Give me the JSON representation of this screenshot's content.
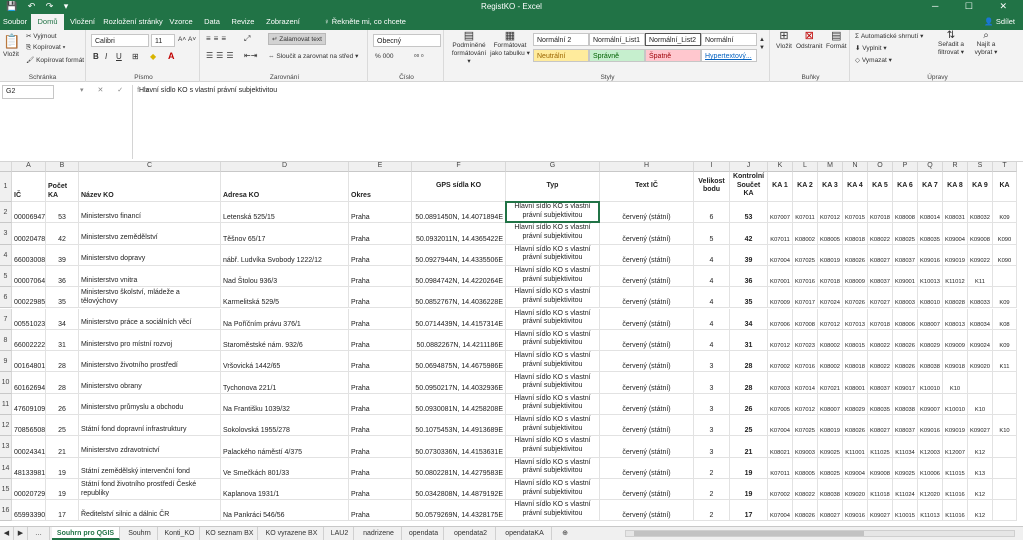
{
  "titlebar": {
    "title": "RegistKO - Excel",
    "qat": "💾 ↶ ↷ ▾",
    "window_controls": "─ ☐ ✕"
  },
  "tabs": [
    "Soubor",
    "Domů",
    "Vložení",
    "Rozložení stránky",
    "Vzorce",
    "Data",
    "Revize",
    "Zobrazení"
  ],
  "tell_me": "Řekněte mi, co chcete udělat...",
  "share": "Sdílet",
  "ribbon": {
    "clipboard": {
      "label": "Schránka",
      "paste": "Vložit",
      "cut": "Vyjmout",
      "copy": "Kopírovat ▾",
      "format_painter": "Kopírovat formát"
    },
    "font": {
      "label": "Písmo",
      "name": "Calibri",
      "size": "11",
      "grow": "A˄",
      "shrink": "A˅",
      "bold": "B",
      "italic": "I",
      "underline": "U"
    },
    "alignment": {
      "label": "Zarovnání",
      "wrap": "Zalamovat text",
      "merge": "Sloučit a zarovnat na střed ▾"
    },
    "number": {
      "label": "Číslo",
      "format": "Obecný",
      "currency": "% 000",
      "dec": "⁰⁰ ⁰"
    },
    "styles": {
      "label": "Styly",
      "conditional": "Podmíněné formátování ▾",
      "as_table": "Formátovat jako tabulku ▾",
      "items": [
        "Normální 2",
        "Normální_List1",
        "Normální_List2",
        "Normální",
        "Neutrální",
        "Správně",
        "Špatně",
        "Hypertextový..."
      ]
    },
    "cells": {
      "label": "Buňky",
      "insert": "Vložit",
      "delete": "Odstranit",
      "format": "Formát"
    },
    "editing": {
      "label": "Úpravy",
      "autosum": "Automatické shrnutí ▾",
      "fill": "Vyplnit ▾",
      "clear": "Vymazat ▾",
      "sort": "Seřadit a filtrovat ▾",
      "find": "Najít a vybrat ▾"
    }
  },
  "namebox": "G2",
  "fx_icons": "▾ ✕ ✓ fx",
  "formula": "Hlavní sídlo KO s vlastní právní subjektivitou",
  "colors": {
    "accent": "#217346",
    "ribbon_bg": "#f3f3f3",
    "neutral": "#ffeb9c",
    "good": "#c6efce",
    "bad": "#ffc7ce"
  },
  "columns": [
    "A",
    "B",
    "C",
    "D",
    "E",
    "F",
    "G",
    "H",
    "I",
    "J",
    "K",
    "L",
    "M",
    "N",
    "O",
    "P",
    "Q",
    "R",
    "S",
    "T"
  ],
  "headers": [
    "IČ",
    "Počet KA",
    "Název KO",
    "Adresa KO",
    "Okres",
    "GPS sídla KO",
    "Typ",
    "Text IČ",
    "Velikost bodu",
    "Kontrolní Součet KA",
    "KA 1",
    "KA 2",
    "KA 3",
    "KA 4",
    "KA 5",
    "KA 6",
    "KA 7",
    "KA 8",
    "KA 9",
    "KA"
  ],
  "rows": [
    {
      "n": "2",
      "a": "00006947",
      "b": "53",
      "c": "Ministerstvo financí",
      "d": "Letenská 525/15",
      "e": "Praha",
      "f": "50.0891450N, 14.4071894E",
      "g": "Hlavní sídlo KO s vlastní právní subjektivitou",
      "h": "červený (státní)",
      "i": "6",
      "j": "53",
      "ka": [
        "K07007",
        "K07011",
        "K07012",
        "K07015",
        "K07018",
        "K08008",
        "K08014",
        "K08031",
        "K08032",
        "K09"
      ]
    },
    {
      "n": "3",
      "a": "00020478",
      "b": "42",
      "c": "Ministerstvo zemědělství",
      "d": "Těšnov 65/17",
      "e": "Praha",
      "f": "50.0932011N, 14.4365422E",
      "g": "Hlavní sídlo KO s vlastní právní subjektivitou",
      "h": "červený (státní)",
      "i": "5",
      "j": "42",
      "ka": [
        "K07011",
        "K08002",
        "K08005",
        "K08018",
        "K08022",
        "K08025",
        "K08035",
        "K09004",
        "K09008",
        "K090"
      ]
    },
    {
      "n": "4",
      "a": "66003008",
      "b": "39",
      "c": "Ministerstvo dopravy",
      "d": "nábř. Ludvíka Svobody 1222/12",
      "e": "Praha",
      "f": "50.0927944N, 14.4335506E",
      "g": "Hlavní sídlo KO s vlastní právní subjektivitou",
      "h": "červený (státní)",
      "i": "4",
      "j": "39",
      "ka": [
        "K07004",
        "K07025",
        "K08019",
        "K08026",
        "K08027",
        "K08037",
        "K09016",
        "K09019",
        "K09022",
        "K090"
      ]
    },
    {
      "n": "5",
      "a": "00007064",
      "b": "36",
      "c": "Ministerstvo vnitra",
      "d": "Nad Štolou 936/3",
      "e": "Praha",
      "f": "50.0984742N, 14.4220264E",
      "g": "Hlavní sídlo KO s vlastní právní subjektivitou",
      "h": "červený (státní)",
      "i": "4",
      "j": "36",
      "ka": [
        "K07001",
        "K07016",
        "K07018",
        "K08009",
        "K08037",
        "K09001",
        "K10013",
        "K11012",
        "K11"
      ]
    },
    {
      "n": "6",
      "a": "00022985",
      "b": "35",
      "c": "Ministerstvo školství, mládeže a tělovýchovy",
      "d": "Karmelitská 529/5",
      "e": "Praha",
      "f": "50.0852767N, 14.4036228E",
      "g": "Hlavní sídlo KO s vlastní právní subjektivitou",
      "h": "červený (státní)",
      "i": "4",
      "j": "35",
      "ka": [
        "K07009",
        "K07017",
        "K07024",
        "K07026",
        "K07027",
        "K08003",
        "K08010",
        "K08028",
        "K08033",
        "K09"
      ]
    },
    {
      "n": "7",
      "a": "00551023",
      "b": "34",
      "c": "Ministerstvo práce a sociálních věcí",
      "d": "Na Poříčním právu 376/1",
      "e": "Praha",
      "f": "50.0714439N, 14.4157314E",
      "g": "Hlavní sídlo KO s vlastní právní subjektivitou",
      "h": "červený (státní)",
      "i": "4",
      "j": "34",
      "ka": [
        "K07006",
        "K07008",
        "K07012",
        "K07013",
        "K07018",
        "K08006",
        "K08007",
        "K08013",
        "K08034",
        "K08"
      ]
    },
    {
      "n": "8",
      "a": "66002222",
      "b": "31",
      "c": "Ministerstvo pro místní rozvoj",
      "d": "Staroměstské nám. 932/6",
      "e": "Praha",
      "f": "50.0882267N, 14.4211186E",
      "g": "Hlavní sídlo KO s vlastní právní subjektivitou",
      "h": "červený (státní)",
      "i": "4",
      "j": "31",
      "ka": [
        "K07012",
        "K07023",
        "K08002",
        "K08015",
        "K08022",
        "K08026",
        "K08029",
        "K09009",
        "K09024",
        "K09"
      ]
    },
    {
      "n": "9",
      "a": "00164801",
      "b": "28",
      "c": "Ministerstvo životního prostředí",
      "d": "Vršovická 1442/65",
      "e": "Praha",
      "f": "50.0694875N, 14.4675986E",
      "g": "Hlavní sídlo KO s vlastní právní subjektivitou",
      "h": "červený (státní)",
      "i": "3",
      "j": "28",
      "ka": [
        "K07002",
        "K07016",
        "K08002",
        "K08018",
        "K08022",
        "K08026",
        "K08038",
        "K09018",
        "K09020",
        "K11"
      ]
    },
    {
      "n": "10",
      "a": "60162694",
      "b": "28",
      "c": "Ministerstvo obrany",
      "d": "Tychonova 221/1",
      "e": "Praha",
      "f": "50.0950217N, 14.4032936E",
      "g": "Hlavní sídlo KO s vlastní právní subjektivitou",
      "h": "červený (státní)",
      "i": "3",
      "j": "28",
      "ka": [
        "K07003",
        "K07014",
        "K07021",
        "K08001",
        "K08037",
        "K09017",
        "K10010",
        "K10"
      ]
    },
    {
      "n": "11",
      "a": "47609109",
      "b": "26",
      "c": "Ministerstvo průmyslu a obchodu",
      "d": "Na Františku 1039/32",
      "e": "Praha",
      "f": "50.0930081N, 14.4258208E",
      "g": "Hlavní sídlo KO s vlastní právní subjektivitou",
      "h": "červený (státní)",
      "i": "3",
      "j": "26",
      "ka": [
        "K07005",
        "K07012",
        "K08007",
        "K08029",
        "K08035",
        "K08038",
        "K09007",
        "K10010",
        "K10"
      ]
    },
    {
      "n": "12",
      "a": "70856508",
      "b": "25",
      "c": "Státní fond dopravní infrastruktury",
      "d": "Sokolovská 1955/278",
      "e": "Praha",
      "f": "50.1075453N, 14.4913689E",
      "g": "Hlavní sídlo KO s vlastní právní subjektivitou",
      "h": "červený (státní)",
      "i": "3",
      "j": "25",
      "ka": [
        "K07004",
        "K07025",
        "K08019",
        "K08026",
        "K08027",
        "K08037",
        "K09016",
        "K09019",
        "K09027",
        "K10"
      ]
    },
    {
      "n": "13",
      "a": "00024341",
      "b": "21",
      "c": "Ministerstvo zdravotnictví",
      "d": "Palackého náměstí 4/375",
      "e": "Praha",
      "f": "50.0730336N, 14.4153631E",
      "g": "Hlavní sídlo KO s vlastní právní subjektivitou",
      "h": "červený (státní)",
      "i": "3",
      "j": "21",
      "ka": [
        "K08021",
        "K09003",
        "K09025",
        "K11001",
        "K11025",
        "K11034",
        "K12003",
        "K12007",
        "K12"
      ]
    },
    {
      "n": "14",
      "a": "48133981",
      "b": "19",
      "c": "Státní zemědělský intervenční fond",
      "d": "Ve Smečkách 801/33",
      "e": "Praha",
      "f": "50.0802281N, 14.4279583E",
      "g": "Hlavní sídlo KO s vlastní právní subjektivitou",
      "h": "červený (státní)",
      "i": "2",
      "j": "19",
      "ka": [
        "K07011",
        "K08005",
        "K08025",
        "K09004",
        "K09008",
        "K09025",
        "K10006",
        "K11015",
        "K13"
      ]
    },
    {
      "n": "15",
      "a": "00020729",
      "b": "19",
      "c": "Státní fond životního prostředí České republiky",
      "d": "Kaplanova 1931/1",
      "e": "Praha",
      "f": "50.0342808N, 14.4879192E",
      "g": "Hlavní sídlo KO s vlastní právní subjektivitou",
      "h": "červený (státní)",
      "i": "2",
      "j": "19",
      "ka": [
        "K07002",
        "K08022",
        "K08038",
        "K09020",
        "K11018",
        "K11024",
        "K12020",
        "K11016",
        "K12"
      ]
    },
    {
      "n": "16",
      "a": "65993390",
      "b": "17",
      "c": "Ředitelství silnic a dálnic ČR",
      "d": "Na Pankráci 546/56",
      "e": "Praha",
      "f": "50.0579269N, 14.4328175E",
      "g": "Hlavní sídlo KO s vlastní právní subjektivitou",
      "h": "červený (státní)",
      "i": "2",
      "j": "17",
      "ka": [
        "K07004",
        "K08026",
        "K08027",
        "K09016",
        "K09027",
        "K10015",
        "K11013",
        "K11016",
        "K12"
      ]
    }
  ],
  "sheets": [
    "Souhrn pro QGIS",
    "Souhrn",
    "Konti_KO",
    "KO seznam BX",
    "KO vyrazene BX",
    "LAU2",
    "nadrizene",
    "opendata",
    "opendata2",
    "opendataKA"
  ],
  "sheet_add": "⊕"
}
